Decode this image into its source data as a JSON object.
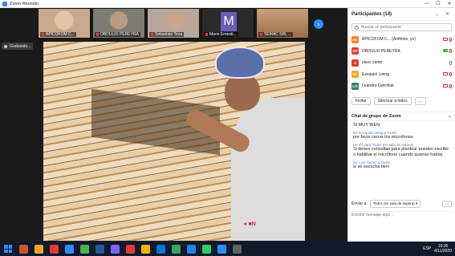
{
  "window": {
    "title": "Zoom Reunión",
    "controls": [
      "—",
      "☐",
      "✕"
    ]
  },
  "participants_strip": [
    {
      "name": "APICOFOM C...",
      "bg": "#c9a98c"
    },
    {
      "name": "OBDULIO PEREYRA",
      "bg": "#7f7c74"
    },
    {
      "name": "Sebastian Teza",
      "bg": "#b7a79a"
    },
    {
      "name": "Mario Ernesti...",
      "letter": "M"
    },
    {
      "name": "SEMAC SRL ...",
      "bg": "#9b6e4b"
    }
  ],
  "next_arrow": "›",
  "recording": {
    "label": "Grabando..."
  },
  "video": {
    "overlay_tag": "♦ ■N"
  },
  "participants_panel": {
    "title": "Participantes (14)",
    "search_placeholder": "Buscar un participante",
    "items": [
      {
        "initials": "AC",
        "color": "#f58220",
        "name": "APICOFOM C... (Anfitrión, yo)",
        "video": "off",
        "mic": "off"
      },
      {
        "initials": "OP",
        "color": "#e53935",
        "name": "OBDULIO PEREYRA",
        "video": "on",
        "mic": "off"
      },
      {
        "initials": "e",
        "color": "#e53935",
        "name": "elsov carter",
        "video": "none",
        "mic": "on"
      },
      {
        "initials": "EL",
        "color": "#f5a623",
        "name": "Ezequiel Lining",
        "video": "off",
        "mic": "off"
      },
      {
        "initials": "LO",
        "color": "#3f7d5a",
        "name": "Leandro Ostrofiuk",
        "video": "off",
        "mic": "off"
      }
    ],
    "invite_label": "Invitar",
    "mute_all_label": "Silenciar a todos",
    "more_label": "..."
  },
  "chat": {
    "title": "Chat de grupo de Zoom",
    "messages": [
      {
        "meta_prefix": "",
        "from": "",
        "meta_suffix": "",
        "text": "SI MUY BIEN"
      },
      {
        "meta_prefix": "De ",
        "from": "Ezequiel Lining",
        "meta_suffix": " a Todos",
        "text": "por favor cerrar los microfonos"
      },
      {
        "meta_prefix": "De mí para ",
        "from": "Todos",
        "meta_suffix": " (en sala de espera)",
        "text": "Si tienen consultas para plantear pueden escribir o habilitar el micrófono cuando quieran hablar"
      },
      {
        "meta_prefix": "De ",
        "from": "Luis Nuñez",
        "meta_suffix": " a Todos",
        "text": "si se escucha bien"
      }
    ],
    "send_to_label": "Enviar a:",
    "send_to_value": "Todos (en sala de espera) ▾",
    "more_label": "...",
    "compose_placeholder": "Escribir mensaje aquí..."
  },
  "taskbar": {
    "icons": [
      "#d35230",
      "#f5a623",
      "#e53935",
      "#2d8cff",
      "#4caf50",
      "#2b579a",
      "#7b61ff",
      "#e53935",
      "#f4b400",
      "#0078d4",
      "#34a853",
      "#1e88e5",
      "#25d366",
      "#2d8cff",
      "#616161"
    ],
    "lang": "ESP",
    "time": "19:26",
    "date": "4/11/2020"
  }
}
